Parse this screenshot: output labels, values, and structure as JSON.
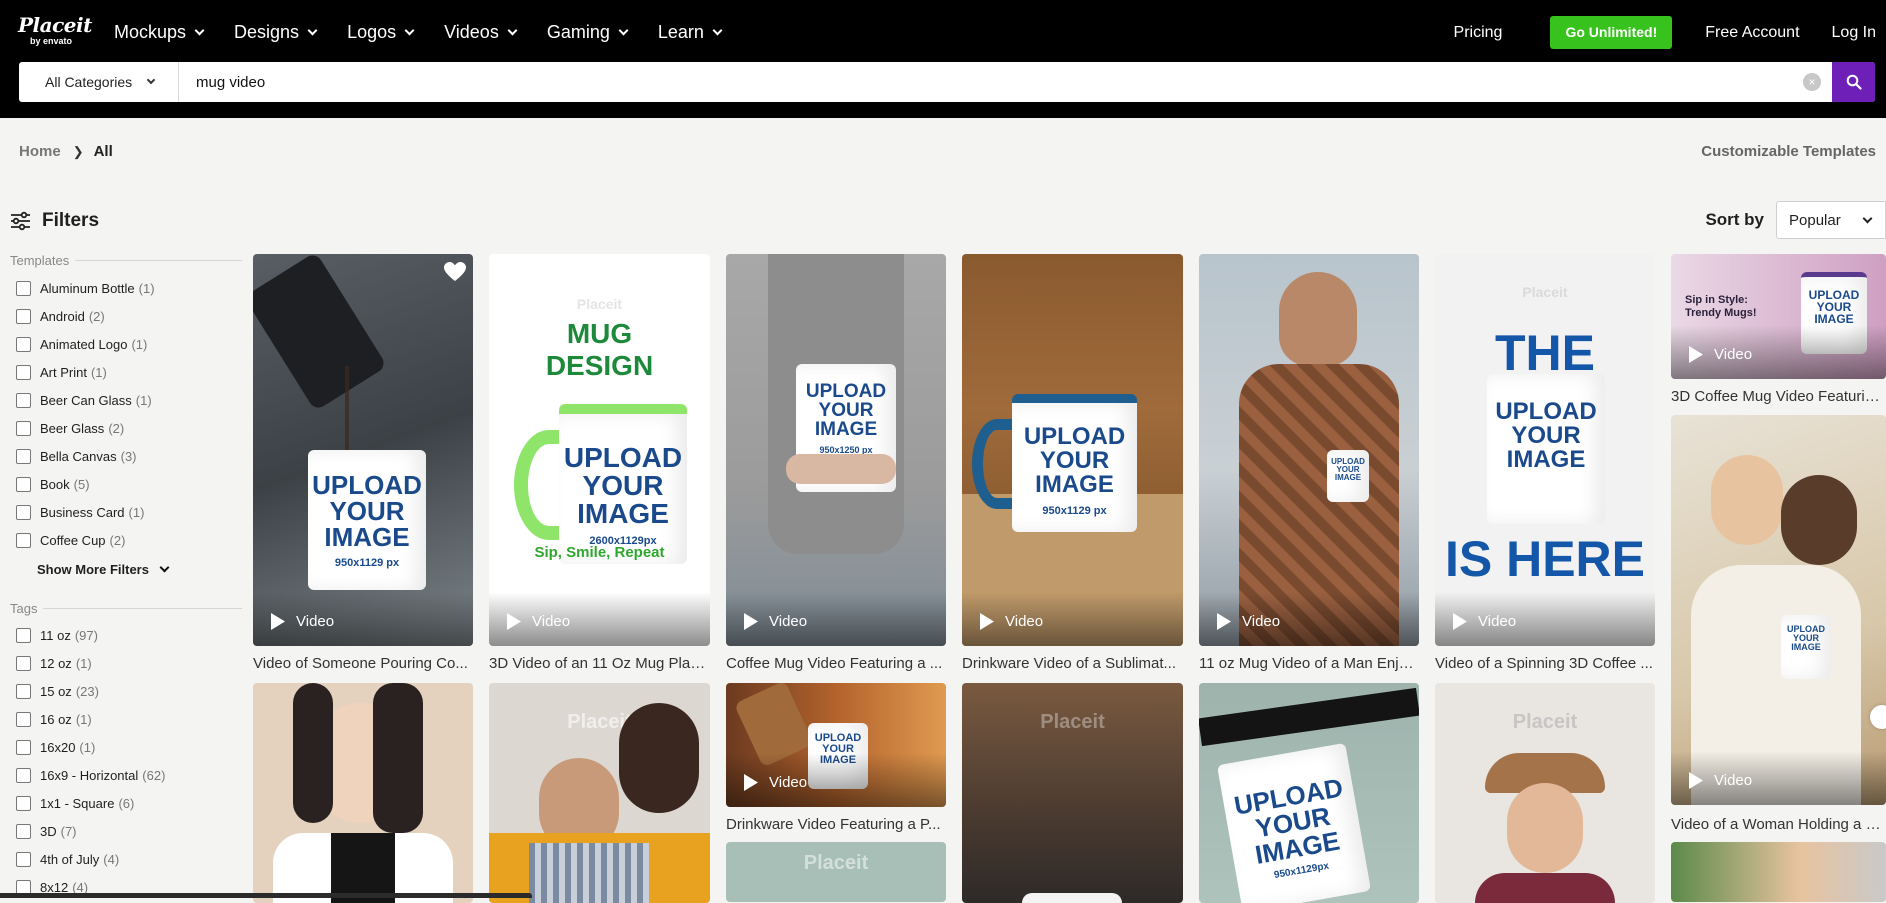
{
  "header": {
    "logo_text": "Placeit",
    "logo_sub": "by envato",
    "nav": [
      "Mockups",
      "Designs",
      "Logos",
      "Videos",
      "Gaming",
      "Learn"
    ],
    "pricing": "Pricing",
    "go_unlimited": "Go Unlimited!",
    "free_account": "Free Account",
    "login": "Log In"
  },
  "search": {
    "category": "All Categories",
    "query": "mug video"
  },
  "breadcrumb": {
    "home": "Home",
    "current": "All"
  },
  "customizable_templates": "Customizable Templates",
  "filters": {
    "title": "Filters",
    "templates_title": "Templates",
    "templates": [
      {
        "label": "Aluminum Bottle",
        "count": "(1)"
      },
      {
        "label": "Android",
        "count": "(2)"
      },
      {
        "label": "Animated Logo",
        "count": "(1)"
      },
      {
        "label": "Art Print",
        "count": "(1)"
      },
      {
        "label": "Beer Can Glass",
        "count": "(1)"
      },
      {
        "label": "Beer Glass",
        "count": "(2)"
      },
      {
        "label": "Bella Canvas",
        "count": "(3)"
      },
      {
        "label": "Book",
        "count": "(5)"
      },
      {
        "label": "Business Card",
        "count": "(1)"
      },
      {
        "label": "Coffee Cup",
        "count": "(2)"
      }
    ],
    "show_more": "Show More Filters",
    "tags_title": "Tags",
    "tags": [
      {
        "label": "11 oz",
        "count": "(97)"
      },
      {
        "label": "12 oz",
        "count": "(1)"
      },
      {
        "label": "15 oz",
        "count": "(23)"
      },
      {
        "label": "16 oz",
        "count": "(1)"
      },
      {
        "label": "16x20",
        "count": "(1)"
      },
      {
        "label": "16x9 - Horizontal",
        "count": "(62)"
      },
      {
        "label": "1x1 - Square",
        "count": "(6)"
      },
      {
        "label": "3D",
        "count": "(7)"
      },
      {
        "label": "4th of July",
        "count": "(4)"
      },
      {
        "label": "8x12",
        "count": "(4)"
      }
    ]
  },
  "sort": {
    "label": "Sort by",
    "value": "Popular"
  },
  "badge_label": "Video",
  "mug_label": {
    "l1": "UPLOAD",
    "l2": "YOUR",
    "l3": "IMAGE"
  },
  "mug_sizes": {
    "c1": "950x1129 px",
    "c2": "2600x1129px",
    "c3": "950x1250 px",
    "c4": "950x1129 px",
    "c5": "950x1129px"
  },
  "card_texts": {
    "mug_design_l1": "MUG",
    "mug_design_l2": "DESIGN",
    "sip_smile": "Sip, Smile, Repeat",
    "the_mug": "THE MUG",
    "is_here": "IS HERE",
    "sip_in_style": "Sip in Style: Trendy Mugs!",
    "watermark": "Placeit"
  },
  "cards": [
    {
      "caption": "Video of Someone Pouring Co..."
    },
    {
      "caption": "3D Video of an 11 Oz Mug Plac..."
    },
    {
      "caption": "Coffee Mug Video Featuring a ..."
    },
    {
      "caption": "Drinkware Video of a Sublimat..."
    },
    {
      "caption": "11 oz Mug Video of a Man Enjo..."
    },
    {
      "caption": "Video of a Spinning 3D Coffee ..."
    },
    {
      "caption": "3D Coffee Mug Video Featuring..."
    },
    {
      "caption": "Drinkware Video Featuring a P..."
    },
    {
      "caption": "Video of a Woman Holding a C..."
    }
  ]
}
